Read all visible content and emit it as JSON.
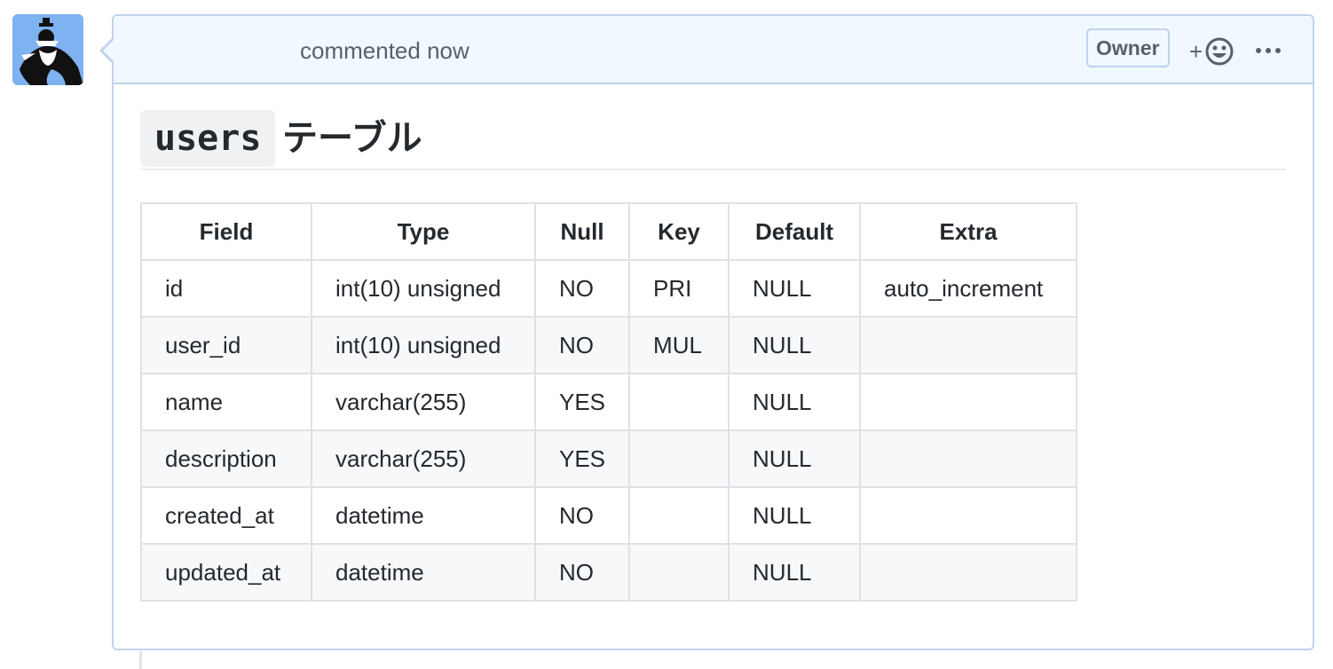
{
  "comment": {
    "meta": "commented now",
    "owner_badge": "Owner",
    "reaction_plus": "+",
    "heading_code": "users",
    "heading_text": "テーブル"
  },
  "table": {
    "headers": [
      "Field",
      "Type",
      "Null",
      "Key",
      "Default",
      "Extra"
    ],
    "rows": [
      [
        "id",
        "int(10) unsigned",
        "NO",
        "PRI",
        "NULL",
        "auto_increment"
      ],
      [
        "user_id",
        "int(10) unsigned",
        "NO",
        "MUL",
        "NULL",
        ""
      ],
      [
        "name",
        "varchar(255)",
        "YES",
        "",
        "NULL",
        ""
      ],
      [
        "description",
        "varchar(255)",
        "YES",
        "",
        "NULL",
        ""
      ],
      [
        "created_at",
        "datetime",
        "NO",
        "",
        "NULL",
        ""
      ],
      [
        "updated_at",
        "datetime",
        "NO",
        "",
        "NULL",
        ""
      ]
    ]
  },
  "colors": {
    "header_bg": "#f1f8ff",
    "border": "#c0d3eb",
    "avatar_bg": "#7fb2f0",
    "text": "#24292e",
    "muted": "#586069"
  },
  "icons": [
    "avatar-image",
    "smiley-icon",
    "kebab-icon"
  ]
}
